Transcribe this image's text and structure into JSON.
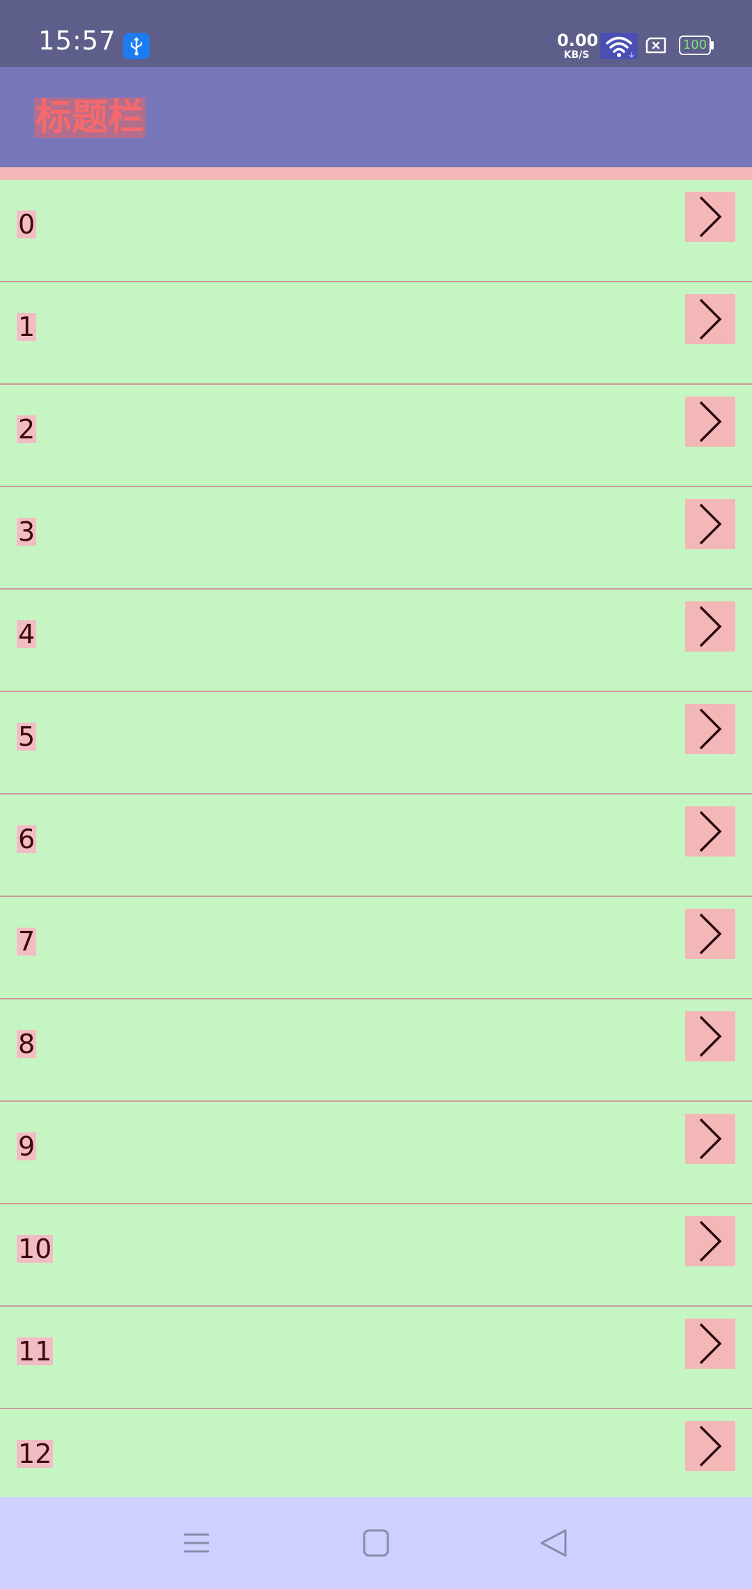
{
  "status_bar": {
    "time": "15:57",
    "net_speed_value": "0.00",
    "net_speed_unit": "KB/S",
    "battery_level": "100",
    "icons": [
      "usb-icon",
      "wifi-icon",
      "sim-card-icon",
      "battery-icon"
    ]
  },
  "title_bar": {
    "title": "标题栏"
  },
  "list": {
    "items": [
      {
        "label": "0"
      },
      {
        "label": "1"
      },
      {
        "label": "2"
      },
      {
        "label": "3"
      },
      {
        "label": "4"
      },
      {
        "label": "5"
      },
      {
        "label": "6"
      },
      {
        "label": "7"
      },
      {
        "label": "8"
      },
      {
        "label": "9"
      },
      {
        "label": "10"
      },
      {
        "label": "11"
      },
      {
        "label": "12"
      }
    ],
    "item_icon": "chevron-right-icon"
  },
  "nav_bar": {
    "buttons": [
      "menu-icon",
      "home-icon",
      "back-icon"
    ]
  },
  "colors": {
    "status_bar_bg": "#5d5f8a",
    "title_bar_bg": "#7776bb",
    "title_text": "#f5696c",
    "list_bg": "#c6f5c4",
    "arrow_button_bg": "#f4b7b7",
    "nav_bar_bg": "#cfd0ff"
  }
}
